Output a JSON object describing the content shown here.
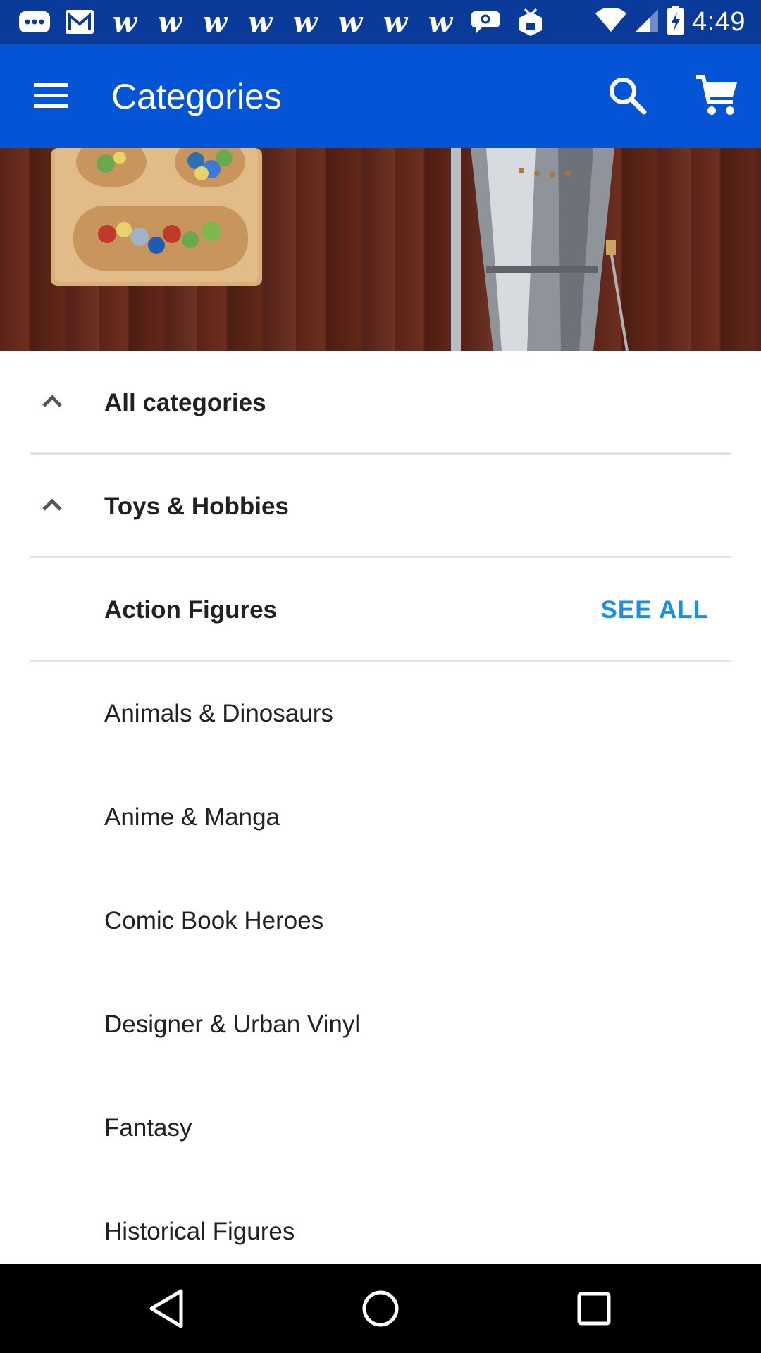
{
  "status_bar": {
    "time": "4:49",
    "notification_icons": [
      "chat-icon",
      "gmail-icon",
      "w-icon",
      "w-icon",
      "w-icon",
      "w-icon",
      "w-icon",
      "w-icon",
      "w-icon",
      "w-icon",
      "speech-bubble-icon",
      "box-icon"
    ],
    "w_glyph": "w"
  },
  "app_bar": {
    "title": "Categories",
    "background_color": "#0654d6"
  },
  "list": {
    "all_categories": "All categories",
    "parent_category": "Toys & Hobbies",
    "subcategory": "Action Figures",
    "see_all": "SEE ALL",
    "items": [
      "Animals & Dinosaurs",
      "Anime & Manga",
      "Comic Book Heroes",
      "Designer & Urban Vinyl",
      "Fantasy",
      "Historical Figures"
    ]
  },
  "colors": {
    "accent": "#1a8fe8",
    "status_bar": "#0b3b9a",
    "divider": "#e3e3e3"
  }
}
